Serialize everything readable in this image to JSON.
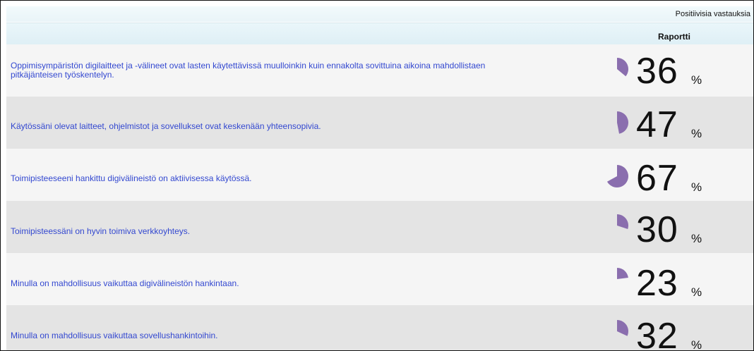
{
  "header": {
    "top_label": "Positiivisia vastauksia",
    "column_label": "Raportti"
  },
  "pie_color": "#8a6eae",
  "rows": [
    {
      "question_line1": "Oppimisympäristön digilaitteet ja -välineet ovat lasten käytettävissä muulloinkin kuin ennakolta sovittuina aikoina mahdollistaen",
      "question_line2": "pitkäjänteisen työskentelyn.",
      "value": 36,
      "value_text": "36",
      "unit": "%"
    },
    {
      "question_line1": "Käytössäni olevat laitteet, ohjelmistot ja sovellukset ovat keskenään yhteensopivia.",
      "question_line2": "",
      "value": 47,
      "value_text": "47",
      "unit": "%"
    },
    {
      "question_line1": "Toimipisteeseeni hankittu digivälineistö on aktiivisessa käytössä.",
      "question_line2": "",
      "value": 67,
      "value_text": "67",
      "unit": "%"
    },
    {
      "question_line1": "Toimipisteessäni on hyvin toimiva verkkoyhteys.",
      "question_line2": "",
      "value": 30,
      "value_text": "30",
      "unit": "%"
    },
    {
      "question_line1": "Minulla on mahdollisuus vaikuttaa digivälineistön hankintaan.",
      "question_line2": "",
      "value": 23,
      "value_text": "23",
      "unit": "%"
    },
    {
      "question_line1": "Minulla on mahdollisuus vaikuttaa sovellushankintoihin.",
      "question_line2": "",
      "value": 32,
      "value_text": "32",
      "unit": "%"
    }
  ]
}
